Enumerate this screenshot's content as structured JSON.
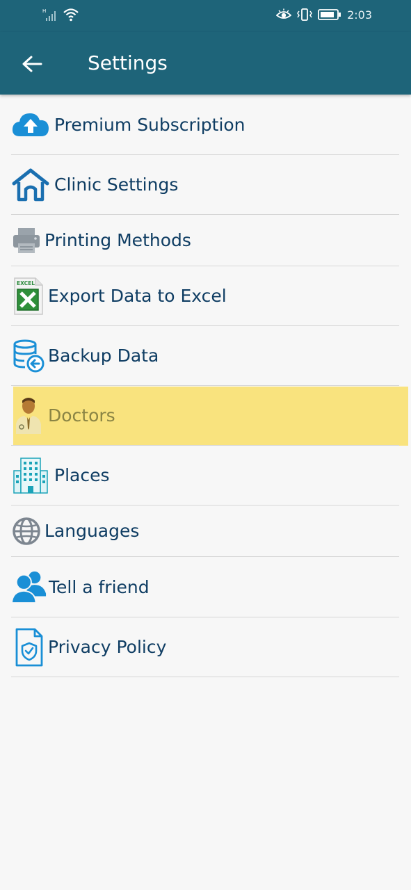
{
  "status_bar": {
    "time": "2:03",
    "icons": [
      "signal-icon",
      "wifi-icon",
      "eye-icon",
      "vibrate-icon",
      "battery-icon"
    ]
  },
  "app_bar": {
    "title": "Settings",
    "back_icon": "arrow-left-icon",
    "background_color": "#1e6479"
  },
  "settings": {
    "items": [
      {
        "label": "Premium Subscription",
        "icon": "cloud-upload-icon"
      },
      {
        "label": "Clinic Settings",
        "icon": "home-icon"
      },
      {
        "label": "Printing Methods",
        "icon": "printer-icon"
      },
      {
        "label": "Export Data to Excel",
        "icon": "excel-icon"
      },
      {
        "label": "Backup Data",
        "icon": "database-backup-icon"
      },
      {
        "label": "Doctors",
        "icon": "doctor-icon",
        "highlighted": true
      },
      {
        "label": "Places",
        "icon": "building-icon"
      },
      {
        "label": "Languages",
        "icon": "globe-icon"
      },
      {
        "label": "Tell a friend",
        "icon": "users-icon"
      },
      {
        "label": "Privacy Policy",
        "icon": "shield-document-icon"
      }
    ]
  },
  "colors": {
    "accent": "#1e6479",
    "label": "#0f3d63",
    "highlight": "#f9e37e",
    "icon_blue": "#1a8fd6"
  }
}
